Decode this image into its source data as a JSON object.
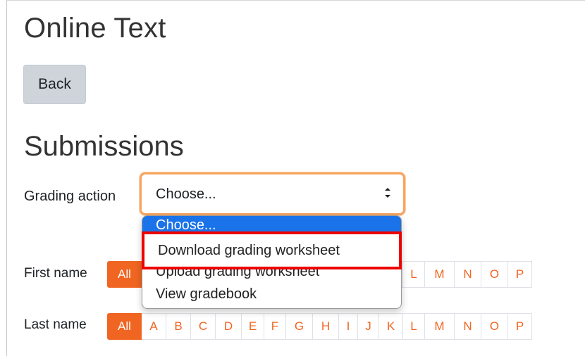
{
  "page": {
    "title": "Online Text",
    "back_label": "Back",
    "section_title": "Submissions"
  },
  "grading": {
    "label": "Grading action",
    "selected_value": "Choose...",
    "options": [
      "Choose...",
      "Download grading worksheet",
      "Upload grading worksheet",
      "View gradebook"
    ],
    "highlighted_option": "Download grading worksheet"
  },
  "filters": {
    "first_name_label": "First name",
    "last_name_label": "Last name",
    "all_label": "All",
    "letters": [
      "A",
      "B",
      "C",
      "D",
      "E",
      "F",
      "G",
      "H",
      "I",
      "J",
      "K",
      "L",
      "M",
      "N",
      "O",
      "P"
    ]
  },
  "colors": {
    "accent": "#f06521",
    "focus_border": "#f7a45f",
    "dropdown_selected": "#1a73e8",
    "annotation": "#ee0000"
  }
}
